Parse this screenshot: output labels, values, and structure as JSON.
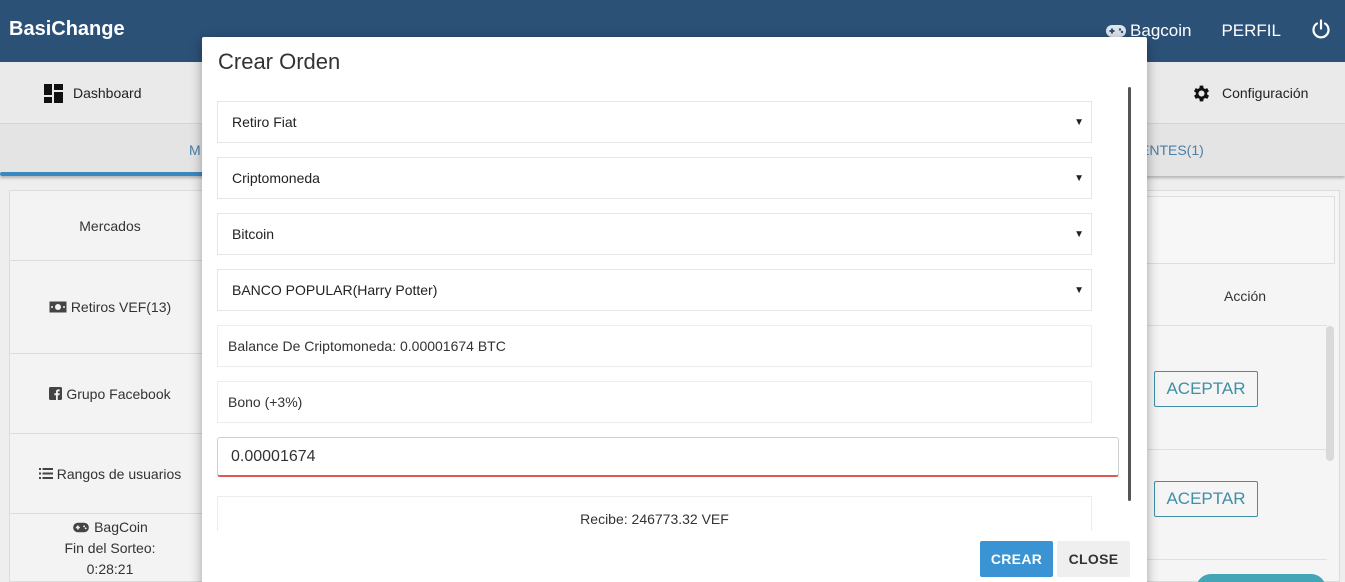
{
  "app": {
    "brand": "BasiChange"
  },
  "topbar": {
    "bagcoin_label": "Bagcoin",
    "perfil_label": "PERFIL"
  },
  "nav": {
    "dashboard_label": "Dashboard",
    "config_label": "Configuración"
  },
  "tabs": {
    "left_partial": "M",
    "right_partial": "ENTES(1)"
  },
  "sidebar": {
    "items": [
      {
        "label": "Mercados"
      },
      {
        "label": "Retiros VEF(13)"
      },
      {
        "label": "Grupo Facebook"
      },
      {
        "label": "Rangos de usuarios"
      }
    ],
    "sorteo": {
      "title": "BagCoin",
      "subtitle": "Fin del Sorteo:",
      "time": "0:28:21"
    }
  },
  "content": {
    "accion_header": "Acción",
    "accept_label": "ACEPTAR"
  },
  "modal": {
    "title": "Crear Orden",
    "selects": [
      {
        "value": "Retiro Fiat"
      },
      {
        "value": "Criptomoneda"
      },
      {
        "value": "Bitcoin"
      },
      {
        "value": "BANCO POPULAR(Harry Potter)"
      }
    ],
    "balance_text": "Balance De Criptomoneda: 0.00001674 BTC",
    "bono_text": "Bono (+3%)",
    "amount_value": "0.00001674",
    "recibe_text": "Recibe: 246773.32 VEF",
    "crear_label": "CREAR",
    "close_label": "CLOSE"
  },
  "colors": {
    "topbar": "#2c5177",
    "primary_button": "#3a93d2",
    "accept_outline": "#3f8fa6",
    "error_underline": "#e05555"
  }
}
